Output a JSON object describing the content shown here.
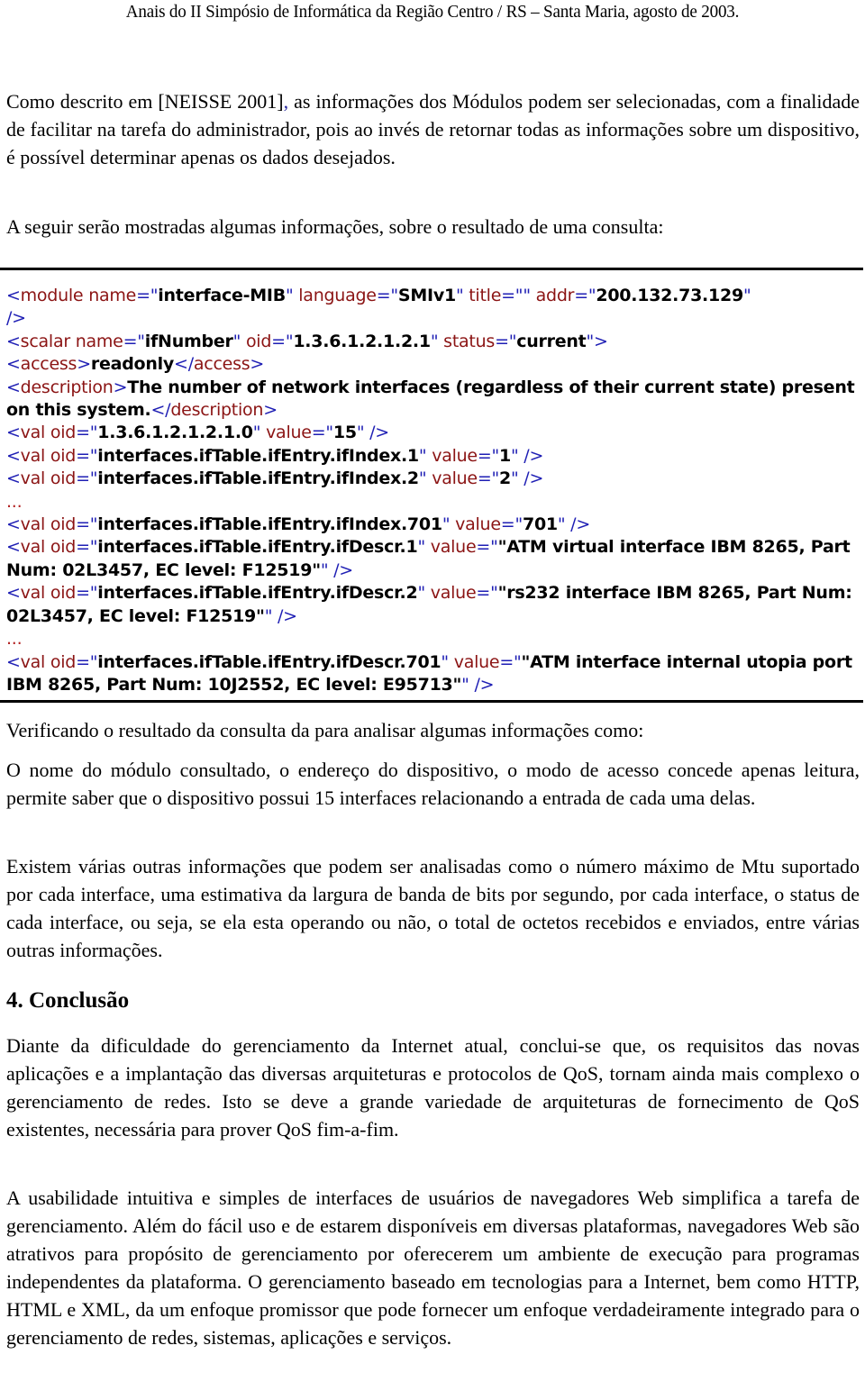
{
  "header": {
    "running_title": "Anais do II Simpósio de Informática da Região Centro / RS – Santa Maria, agosto de 2003."
  },
  "paragraphs": {
    "intro_pre": "Como descrito em [NEISSE 2001]",
    "intro_comma": ",",
    "intro_post": " as informações dos Módulos podem ser selecionadas, com a finalidade de facilitar na tarefa do administrador, pois ao invés de retornar todas as informações sobre um dispositivo, é possível determinar apenas os dados desejados.",
    "lead_in": "A seguir serão mostradas algumas informações, sobre o resultado de uma consulta:",
    "after_code": "Verificando o resultado da consulta da para analisar algumas informações como:",
    "summary": "O nome do módulo consultado, o endereço do dispositivo, o modo de acesso concede apenas leitura, permite saber que o dispositivo possui 15 interfaces relacionando a entrada de cada uma delas.",
    "others": "Existem várias outras informações que podem ser analisadas como o número máximo de Mtu suportado por cada interface, uma estimativa da largura de banda de bits por segundo, por cada interface, o status de cada interface, ou seja, se ela esta operando ou não, o total de octetos recebidos e enviados, entre várias outras informações."
  },
  "code_listing": {
    "module": {
      "tag": "module",
      "attrs": [
        {
          "name": "name",
          "value": "interface-MIB"
        },
        {
          "name": "language",
          "value": "SMIv1"
        },
        {
          "name": "title",
          "value": ""
        },
        {
          "name": "addr",
          "value": "200.132.73.129"
        }
      ],
      "close": "/>"
    },
    "scalar": {
      "tag": "scalar",
      "attrs": [
        {
          "name": "name",
          "value": "ifNumber"
        },
        {
          "name": "oid",
          "value": "1.3.6.1.2.1.2.1"
        },
        {
          "name": "status",
          "value": "current"
        }
      ]
    },
    "access": {
      "tag": "access",
      "value": "readonly"
    },
    "description": {
      "tag": "description",
      "value": "The number of network interfaces (regardless of their current state) present on this system."
    },
    "vals": [
      {
        "oid": "1.3.6.1.2.1.2.1.0",
        "value": "15"
      },
      {
        "oid": "interfaces.ifTable.ifEntry.ifIndex.1",
        "value": "1"
      },
      {
        "oid": "interfaces.ifTable.ifEntry.ifIndex.2",
        "value": "2"
      },
      {
        "ellipsis": "..."
      },
      {
        "oid": "interfaces.ifTable.ifEntry.ifIndex.701",
        "value": "701"
      },
      {
        "oid": "interfaces.ifTable.ifEntry.ifDescr.1",
        "value": "\"ATM virtual interface IBM 8265, Part Num: 02L3457, EC level: F12519\""
      },
      {
        "oid": "interfaces.ifTable.ifEntry.ifDescr.2",
        "value": "\"rs232 interface IBM 8265, Part Num: 02L3457, EC level: F12519\""
      },
      {
        "ellipsis": "..."
      },
      {
        "oid": "interfaces.ifTable.ifEntry.ifDescr.701",
        "value": "\"ATM interface internal utopia port IBM 8265, Part Num: 10J2552, EC level: E95713\""
      }
    ],
    "val_tag": "val",
    "oid_attr": "oid",
    "value_attr": "value"
  },
  "section": {
    "number": "4.",
    "title": "Conclusão",
    "paragraphs": [
      "Diante da dificuldade do gerenciamento da Internet atual, conclui-se que, os requisitos das novas aplicações e a implantação das diversas arquiteturas e protocolos de QoS, tornam ainda mais complexo o gerenciamento de redes. Isto se deve a grande variedade de arquiteturas de fornecimento de QoS existentes, necessária para prover QoS fim-a-fim.",
      "A usabilidade intuitiva e simples de interfaces de usuários de navegadores Web simplifica a tarefa de gerenciamento. Além do fácil uso e de estarem disponíveis em diversas plataformas, navegadores Web são atrativos para propósito de gerenciamento por oferecerem um ambiente de execução para programas independentes da plataforma. O gerenciamento baseado em tecnologias para a Internet, bem como HTTP, HTML e XML, da um enfoque promissor que pode fornecer um enfoque verdadeiramente integrado para o gerenciamento de redes, sistemas, aplicações e serviços."
    ]
  },
  "colors": {
    "tag_name": "#8b1414",
    "punctuation": "#1e1eb4",
    "value": "#000000",
    "rule": "#000000"
  }
}
